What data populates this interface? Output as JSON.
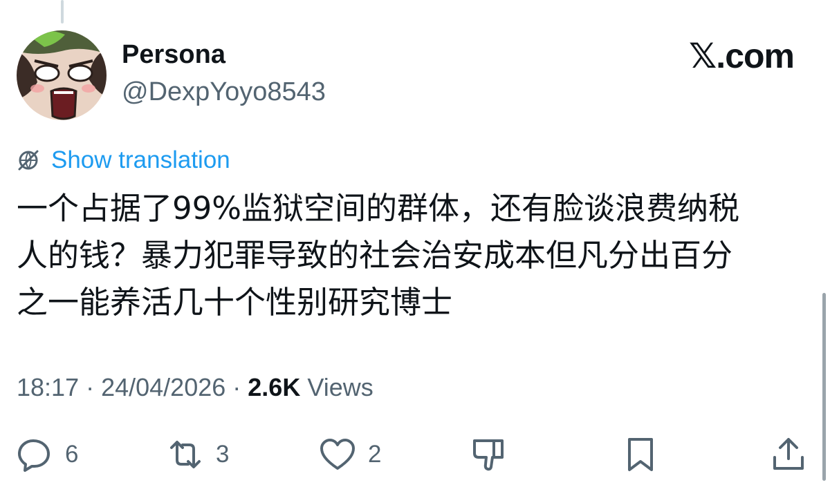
{
  "author": {
    "display_name": "Persona",
    "handle": "@DexpYoyo8543"
  },
  "brand": "𝕏.com",
  "translation": {
    "label": "Show translation",
    "icon": "globe-slash-icon"
  },
  "tweet": {
    "lines": [
      "一个占据了99%监狱空间的群体，还有脸谈浪费纳税",
      "人的钱？暴力犯罪导致的社会治安成本但凡分出百分",
      "之一能养活几十个性别研究博士"
    ]
  },
  "meta": {
    "time": "18:17",
    "separator": " · ",
    "date": "24/04/2026",
    "views_count": "2.6K",
    "views_label": " Views"
  },
  "actions": [
    {
      "name": "reply",
      "icon": "comment-icon",
      "count": "6"
    },
    {
      "name": "repost",
      "icon": "repost-icon",
      "count": "3"
    },
    {
      "name": "like",
      "icon": "heart-icon",
      "count": "2"
    },
    {
      "name": "dislike",
      "icon": "thumbs-down-icon",
      "count": ""
    },
    {
      "name": "bookmark",
      "icon": "bookmark-icon",
      "count": ""
    },
    {
      "name": "share",
      "icon": "share-icon",
      "count": ""
    }
  ],
  "colors": {
    "link": "#1d9bf0",
    "secondary_text": "#536471",
    "primary_text": "#0f1419"
  }
}
